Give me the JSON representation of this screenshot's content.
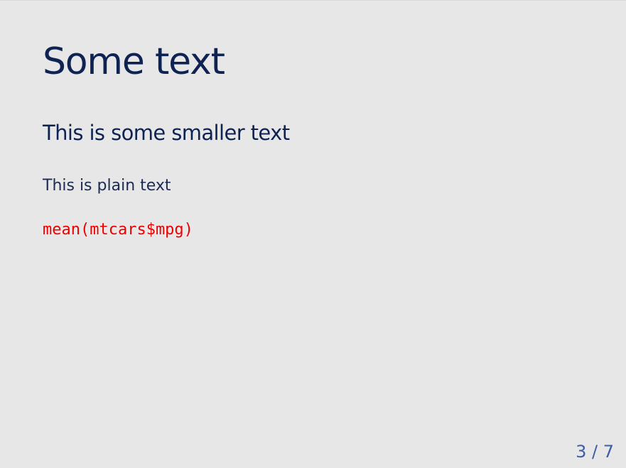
{
  "slide": {
    "title": "Some text",
    "subtitle": "This is some smaller text",
    "plain_text": "This is plain text",
    "code": "mean(mtcars$mpg)",
    "page_number": "3 / 7"
  },
  "colors": {
    "background": "#e7e7e8",
    "heading": "#0f2352",
    "code": "#ee0000",
    "page_number": "#3b5fa6"
  }
}
